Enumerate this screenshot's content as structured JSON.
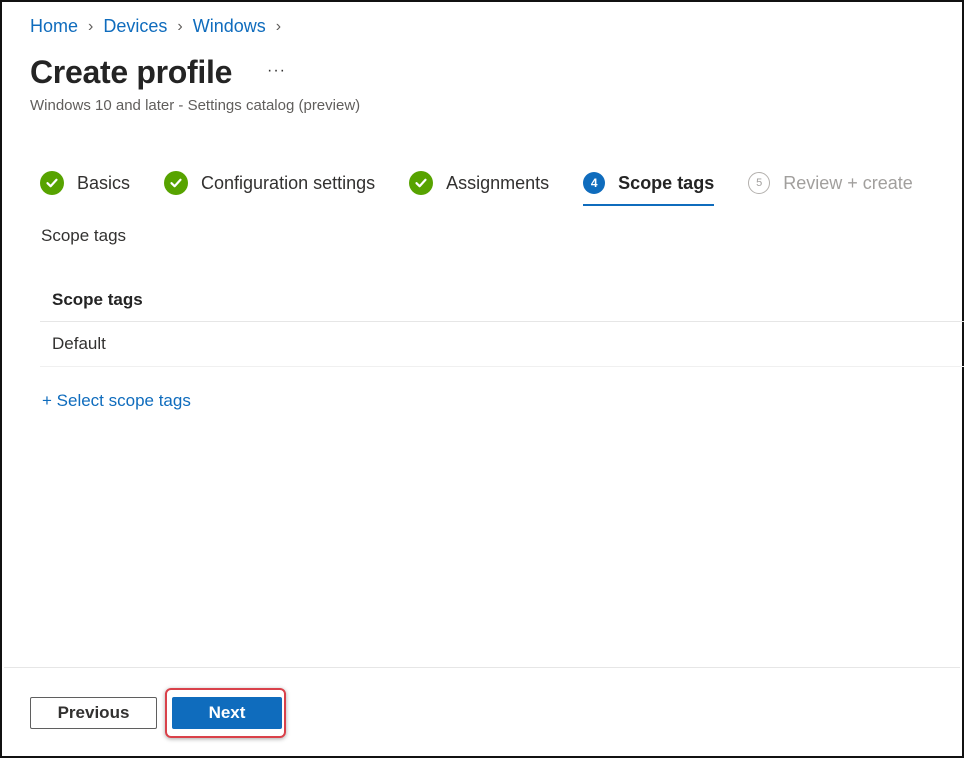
{
  "breadcrumb": [
    {
      "label": "Home"
    },
    {
      "label": "Devices"
    },
    {
      "label": "Windows"
    }
  ],
  "header": {
    "title": "Create profile",
    "more_label": "···",
    "subtitle": "Windows 10 and later - Settings catalog (preview)"
  },
  "steps": [
    {
      "label": "Basics",
      "state": "done",
      "badge": ""
    },
    {
      "label": "Configuration settings",
      "state": "done",
      "badge": ""
    },
    {
      "label": "Assignments",
      "state": "done",
      "badge": ""
    },
    {
      "label": "Scope tags",
      "state": "current",
      "badge": "4"
    },
    {
      "label": "Review + create",
      "state": "pending",
      "badge": "5"
    }
  ],
  "main": {
    "section_label": "Scope tags",
    "table": {
      "header": "Scope tags",
      "rows": [
        "Default"
      ]
    },
    "add_link": "+ Select scope tags"
  },
  "footer": {
    "previous_label": "Previous",
    "next_label": "Next"
  },
  "colors": {
    "accent": "#0f6cbd",
    "success": "#57a300",
    "highlight": "#d9414a"
  }
}
